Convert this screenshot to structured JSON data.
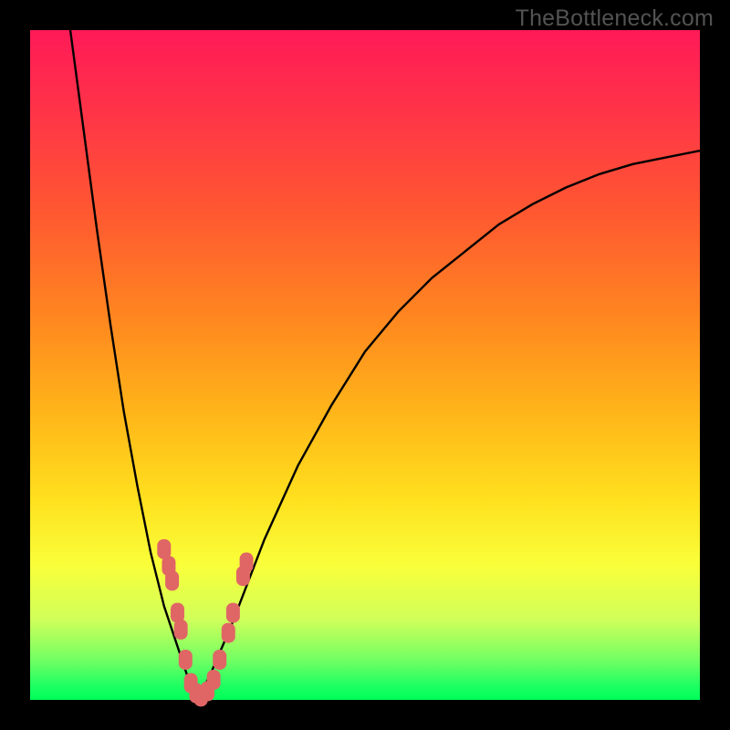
{
  "watermark": "TheBottleneck.com",
  "colors": {
    "frame": "#000000",
    "curve": "#000000",
    "marker_fill": "#e06666",
    "marker_stroke": "#d94f4f"
  },
  "chart_data": {
    "type": "line",
    "title": "",
    "xlabel": "",
    "ylabel": "",
    "xlim": [
      0,
      100
    ],
    "ylim": [
      0,
      100
    ],
    "series": [
      {
        "name": "left-branch",
        "x": [
          6,
          8,
          10,
          12,
          14,
          16,
          18,
          19,
          20,
          21,
          22,
          23,
          24,
          25
        ],
        "y": [
          100,
          85,
          70,
          56,
          43,
          32,
          22,
          18,
          14,
          11,
          8,
          5,
          2,
          0
        ]
      },
      {
        "name": "right-branch",
        "x": [
          25,
          27,
          30,
          35,
          40,
          45,
          50,
          55,
          60,
          65,
          70,
          75,
          80,
          85,
          90,
          95,
          100
        ],
        "y": [
          0,
          4,
          11,
          24,
          35,
          44,
          52,
          58,
          63,
          67,
          71,
          74,
          76.5,
          78.5,
          80,
          81,
          82
        ]
      }
    ],
    "markers": {
      "name": "sample-points",
      "shape": "rounded-rect",
      "points": [
        {
          "x": 20.0,
          "y": 22.5
        },
        {
          "x": 20.7,
          "y": 20.0
        },
        {
          "x": 21.2,
          "y": 17.8
        },
        {
          "x": 22.0,
          "y": 13.0
        },
        {
          "x": 22.5,
          "y": 10.5
        },
        {
          "x": 23.2,
          "y": 6.0
        },
        {
          "x": 24.0,
          "y": 2.5
        },
        {
          "x": 24.8,
          "y": 1.0
        },
        {
          "x": 25.5,
          "y": 0.5
        },
        {
          "x": 26.5,
          "y": 1.3
        },
        {
          "x": 27.4,
          "y": 3.0
        },
        {
          "x": 28.3,
          "y": 6.0
        },
        {
          "x": 29.6,
          "y": 10.0
        },
        {
          "x": 30.3,
          "y": 13.0
        },
        {
          "x": 31.8,
          "y": 18.5
        },
        {
          "x": 32.3,
          "y": 20.5
        }
      ]
    }
  }
}
